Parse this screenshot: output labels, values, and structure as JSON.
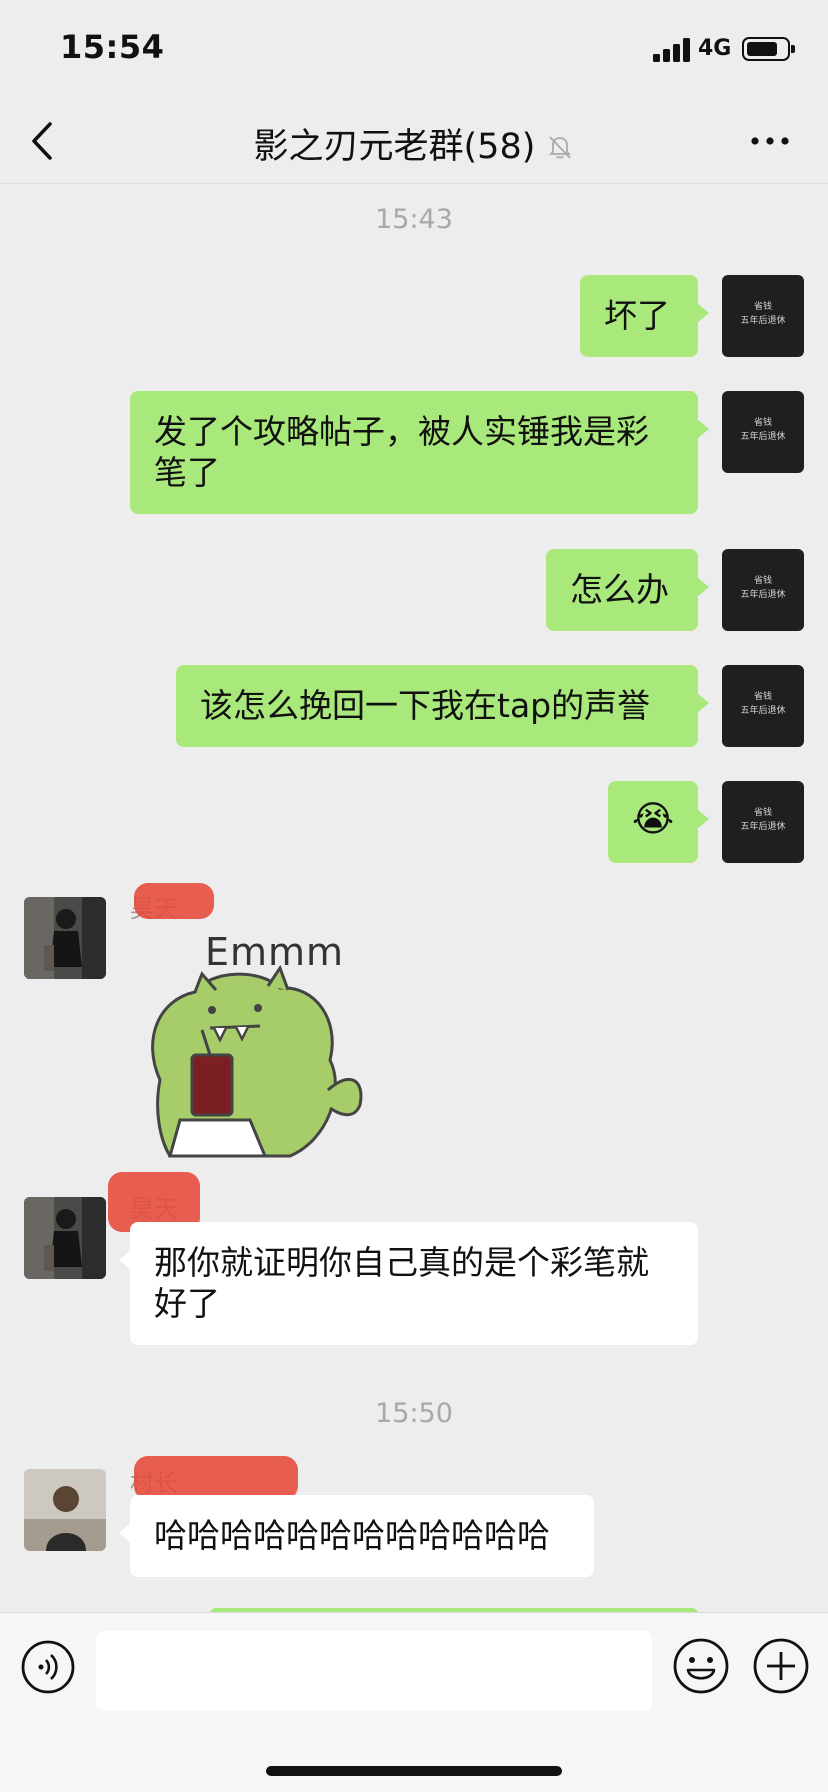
{
  "status_bar": {
    "time": "15:54",
    "network": "4G"
  },
  "header": {
    "title": "影之刃元老群(58)"
  },
  "chat": {
    "timestamps": [
      "15:43",
      "15:50"
    ],
    "my_avatar": {
      "line1": "省钱",
      "line2": "五年后退休"
    },
    "outgoing": [
      {
        "text": "坏了"
      },
      {
        "text": "发了个攻略帖子，被人实锤我是彩笔了"
      },
      {
        "text": "怎么办"
      },
      {
        "text": "该怎么挽回一下我在tap的声誉"
      },
      {
        "text": "😭"
      }
    ],
    "incoming": [
      {
        "sender": "昊天",
        "sticker_text": "Emmm"
      },
      {
        "sender": "昊天",
        "text": "那你就证明你自己真的是个彩笔就好了"
      },
      {
        "sender": "村长",
        "text": "哈哈哈哈哈哈哈哈哈哈哈哈"
      }
    ]
  },
  "input_bar": {
    "placeholder": ""
  },
  "colors": {
    "background": "#ededed",
    "my_bubble": "#a9e87a",
    "their_bubble": "#ffffff",
    "redaction": "#e64a3a"
  }
}
